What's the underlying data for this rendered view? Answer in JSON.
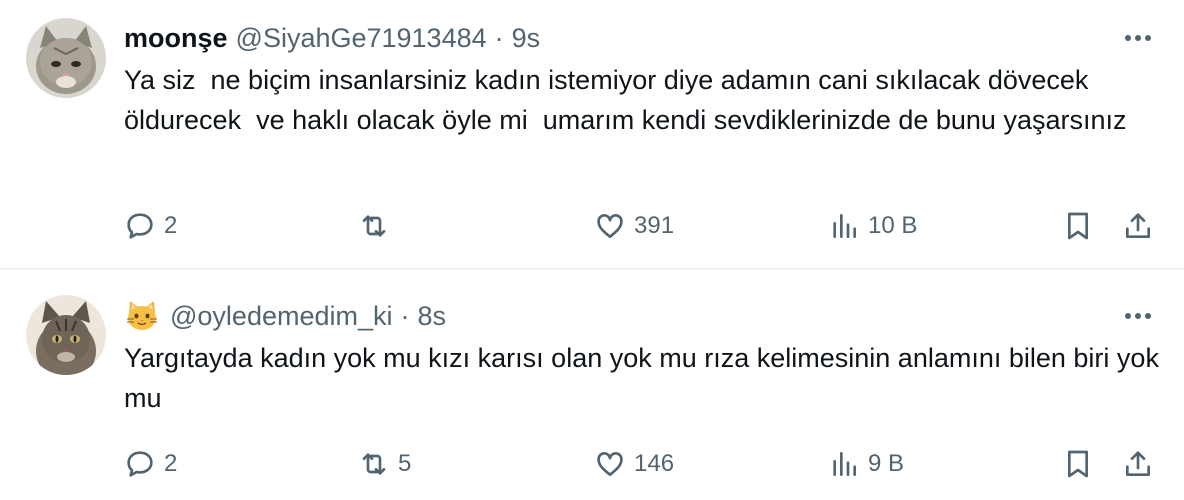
{
  "tweets": [
    {
      "name": "moonşe",
      "handle": "@SiyahGe71913484",
      "separator": "·",
      "time": "9s",
      "text": "Ya siz  ne biçim insanlarsiniz kadın istemiyor diye adamın cani sıkılacak dövecek öldurecek  ve haklı olacak öyle mi  umarım kendi sevdiklerinizde de bunu yaşarsınız",
      "replies": "2",
      "retweets": "",
      "likes": "391",
      "views": "10 B"
    },
    {
      "name": "",
      "name_emoji": "cat-face",
      "handle": "@oyledemedim_ki",
      "separator": "·",
      "time": "8s",
      "text": "Yargıtayda kadın yok mu kızı karısı olan yok mu rıza kelimesinin anlamını bilen biri yok mu",
      "replies": "2",
      "retweets": "5",
      "likes": "146",
      "views": "9 B"
    }
  ],
  "icons": {
    "more": "more-icon",
    "reply": "reply-icon",
    "retweet": "retweet-icon",
    "like": "heart-icon",
    "views": "views-icon",
    "bookmark": "bookmark-icon",
    "share": "share-icon"
  },
  "colors": {
    "text": "#0f1419",
    "secondary": "#536471",
    "divider": "#eff3f4"
  }
}
